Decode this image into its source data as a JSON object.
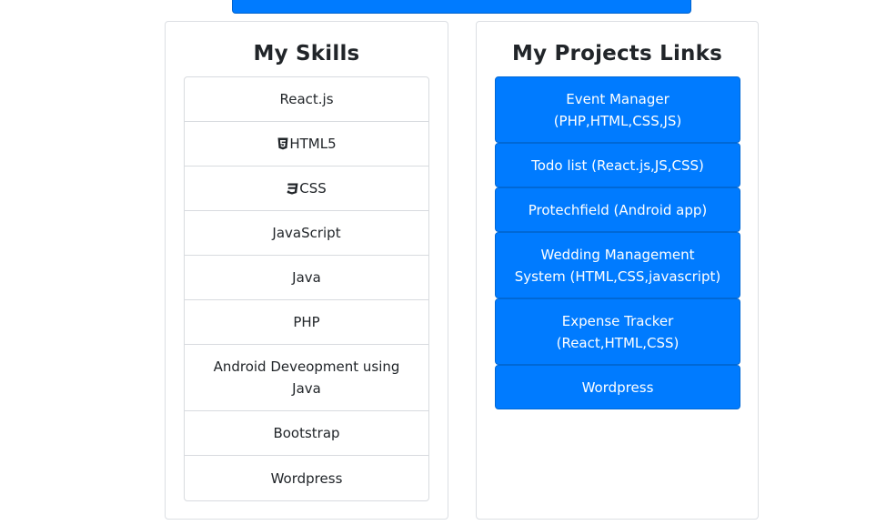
{
  "skills_card": {
    "title": "My Skills",
    "items": [
      {
        "label": "React.js",
        "icon": ""
      },
      {
        "label": "HTML5",
        "icon": "html5-icon"
      },
      {
        "label": "CSS",
        "icon": "css3-icon"
      },
      {
        "label": "JavaScript",
        "icon": ""
      },
      {
        "label": "Java",
        "icon": ""
      },
      {
        "label": "PHP",
        "icon": ""
      },
      {
        "label": "Android Deveopment using Java",
        "icon": ""
      },
      {
        "label": "Bootstrap",
        "icon": ""
      },
      {
        "label": "Wordpress",
        "icon": ""
      }
    ]
  },
  "projects_card": {
    "title": "My Projects Links",
    "items": [
      {
        "label": "Event Manager (PHP,HTML,CSS,JS)"
      },
      {
        "label": "Todo list (React.js,JS,CSS)"
      },
      {
        "label": "Protechfield (Android app)"
      },
      {
        "label": "Wedding Management System (HTML,CSS,javascript)"
      },
      {
        "label": "Expense Tracker (React,HTML,CSS)"
      },
      {
        "label": "Wordpress"
      }
    ]
  },
  "colors": {
    "primary": "#007bff",
    "border": "#dcdfe3",
    "text": "#212529",
    "button_text": "#ffffff"
  }
}
